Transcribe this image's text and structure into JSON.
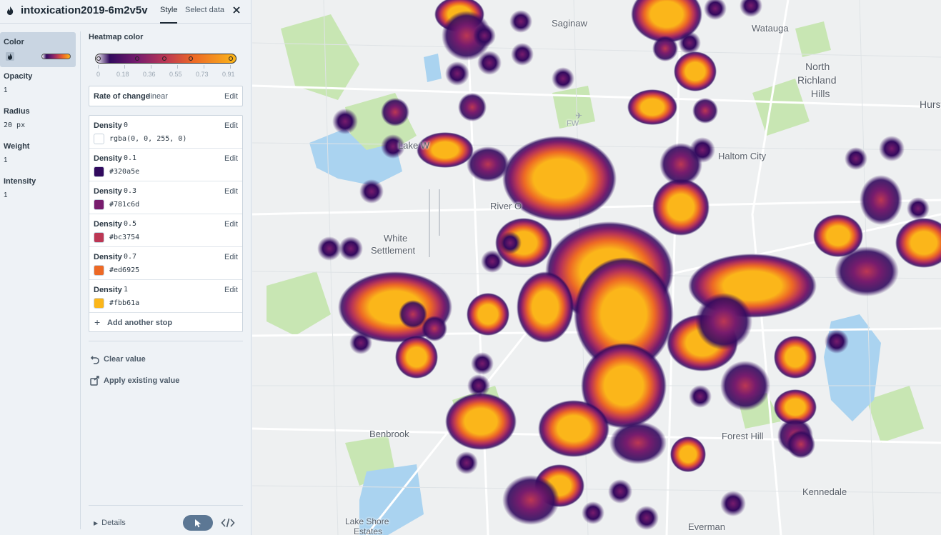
{
  "layer": {
    "name": "intoxication2019-6m2v5v"
  },
  "tabs": {
    "style": "Style",
    "select_data": "Select data"
  },
  "properties": {
    "color": {
      "label": "Color"
    },
    "opacity": {
      "label": "Opacity",
      "value": "1"
    },
    "radius": {
      "label": "Radius",
      "value": "20 px"
    },
    "weight": {
      "label": "Weight",
      "value": "1"
    },
    "intensity": {
      "label": "Intensity",
      "value": "1"
    }
  },
  "editor": {
    "title": "Heatmap color",
    "ticks": [
      "0",
      "0.18",
      "0.36",
      "0.55",
      "0.73",
      "0.91"
    ],
    "rate": {
      "label": "Rate of change",
      "value": "linear",
      "edit": "Edit"
    },
    "density_label": "Density",
    "stops": [
      {
        "density": "0",
        "color": "rgba(0, 0, 255, 0)",
        "swatch": "#ffffff",
        "edit": "Edit"
      },
      {
        "density": "0.1",
        "color": "#320a5e",
        "swatch": "#320a5e",
        "edit": "Edit"
      },
      {
        "density": "0.3",
        "color": "#781c6d",
        "swatch": "#781c6d",
        "edit": "Edit"
      },
      {
        "density": "0.5",
        "color": "#bc3754",
        "swatch": "#bc3754",
        "edit": "Edit"
      },
      {
        "density": "0.7",
        "color": "#ed6925",
        "swatch": "#ed6925",
        "edit": "Edit"
      },
      {
        "density": "1",
        "color": "#fbb61a",
        "swatch": "#fbb61a",
        "edit": "Edit"
      }
    ],
    "add_stop": "Add another stop",
    "clear_value": "Clear value",
    "apply_existing": "Apply existing value"
  },
  "footer": {
    "details": "Details"
  },
  "map": {
    "places": {
      "saginaw": "Saginaw",
      "watauga": "Watauga",
      "north": "North",
      "richland": "Richland",
      "hills": "Hills",
      "hurst": "Hurst",
      "lake_worth": "Lake W",
      "haltom": "Haltom City",
      "river_oaks": "River O",
      "white": "White",
      "settlement": "Settlement",
      "benbrook": "Benbrook",
      "forest_hill": "Forest Hill",
      "kennedale": "Kennedale",
      "lake_shore": "Lake Shore",
      "estates": "Estates",
      "everman": "Everman",
      "fw": "FW"
    }
  }
}
